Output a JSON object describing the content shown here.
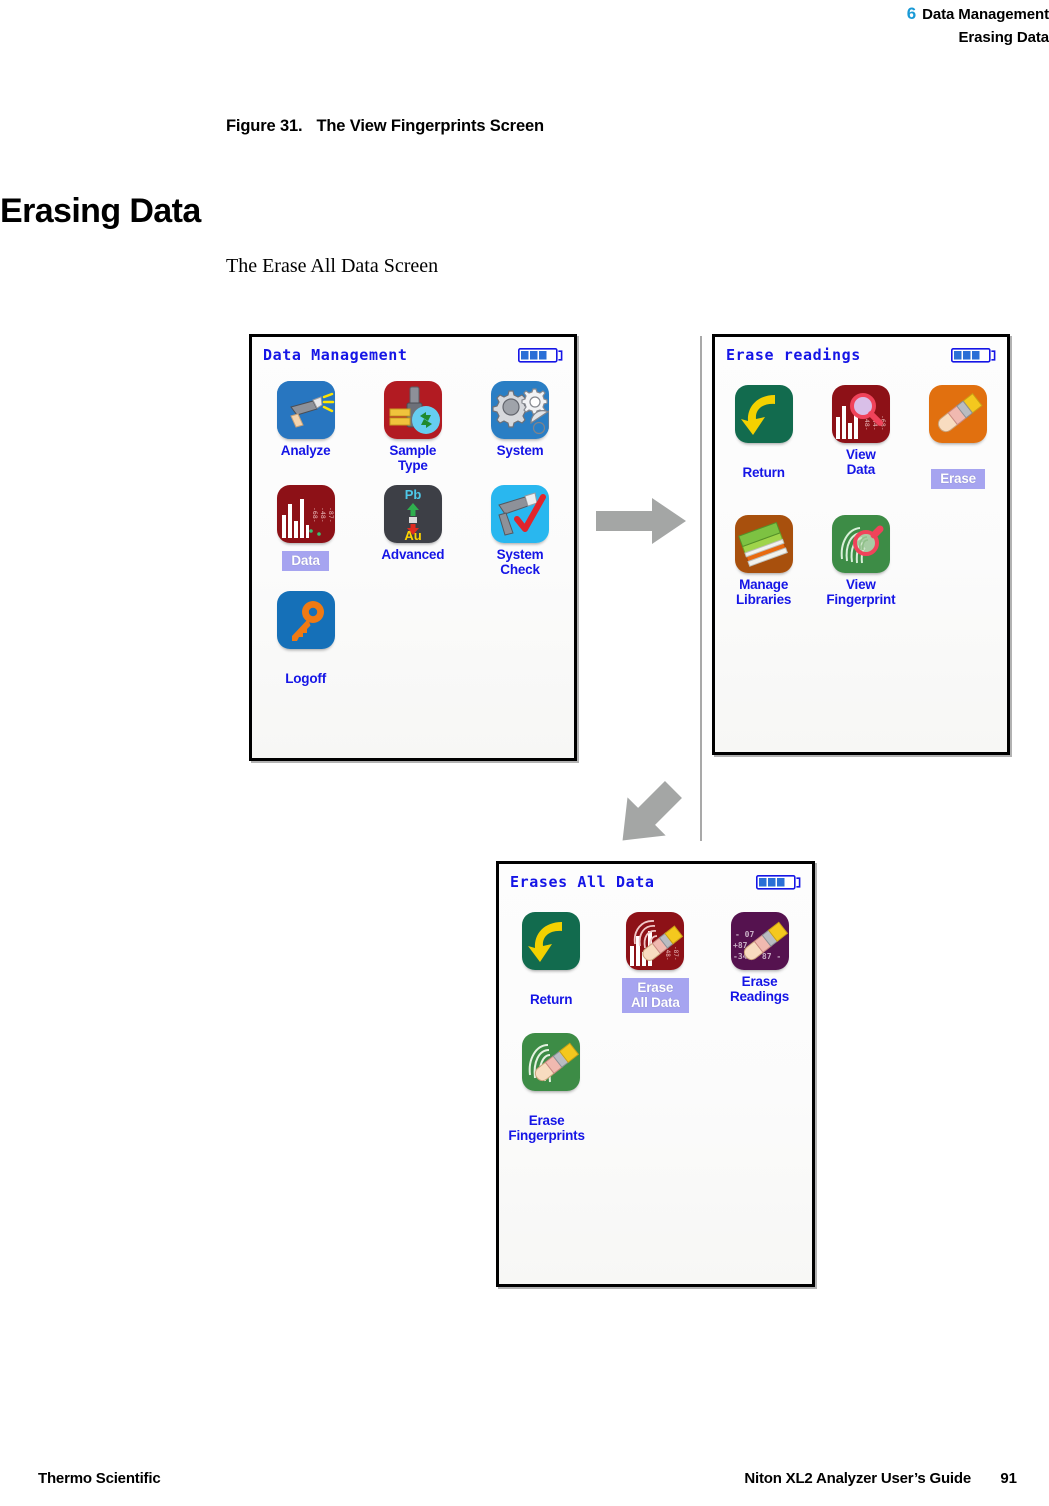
{
  "running_head": {
    "chapter_number": "6",
    "chapter_title": "Data Management",
    "section_title": "Erasing Data"
  },
  "figure_caption": {
    "number": "Figure 31.",
    "text": "The View Fingerprints Screen"
  },
  "heading": "Erasing Data",
  "body_text": "The Erase All Data Screen",
  "colors": {
    "accent_blue": "#1a9ad6",
    "screen_label_blue": "#1515e6",
    "selection_purple": "#a6a4f0",
    "arrow_gray": "#a9a9a9"
  },
  "screens": [
    {
      "title": "Data Management",
      "battery_icon": "battery-icon",
      "battery_bars": 3,
      "items": [
        {
          "label": "Analyze",
          "icon": "analyzer-gun-icon",
          "selected": false
        },
        {
          "label": "Sample\nType",
          "icon": "sample-type-icon",
          "selected": false
        },
        {
          "label": "System",
          "icon": "gears-icon",
          "selected": false
        },
        {
          "label": "Data",
          "icon": "spectrum-chart-icon",
          "selected": true
        },
        {
          "label": "Advanced",
          "icon": "pb-au-icon",
          "selected": false
        },
        {
          "label": "System\nCheck",
          "icon": "system-check-icon",
          "selected": false
        },
        {
          "label": "Logoff",
          "icon": "key-icon",
          "selected": false
        }
      ]
    },
    {
      "title": "Erase readings",
      "battery_icon": "battery-icon",
      "battery_bars": 3,
      "items": [
        {
          "label": "Return",
          "icon": "return-arrow-icon",
          "selected": false
        },
        {
          "label": "View\nData",
          "icon": "view-data-icon",
          "selected": false
        },
        {
          "label": "Erase",
          "icon": "eraser-icon",
          "selected": true
        },
        {
          "label": "Manage\nLibraries",
          "icon": "books-icon",
          "selected": false
        },
        {
          "label": "View\nFingerprint",
          "icon": "view-fingerprint-icon",
          "selected": false
        }
      ]
    },
    {
      "title": "Erases All Data",
      "battery_icon": "battery-icon",
      "battery_bars": 3,
      "items": [
        {
          "label": "Return",
          "icon": "return-arrow-icon",
          "selected": false
        },
        {
          "label": "Erase\nAll Data",
          "icon": "erase-all-data-icon",
          "selected": true
        },
        {
          "label": "Erase\nReadings",
          "icon": "erase-readings-icon",
          "selected": false
        },
        {
          "label": "Erase\nFingerprints",
          "icon": "erase-fingerprints-icon",
          "selected": false
        }
      ]
    }
  ],
  "arrows": [
    {
      "name": "flow-arrow-right",
      "direction": "right"
    },
    {
      "name": "flow-arrow-down-left",
      "direction": "down-left"
    }
  ],
  "footer": {
    "left": "Thermo Scientific",
    "right": "Niton XL2 Analyzer User’s Guide",
    "page_number": "91"
  }
}
